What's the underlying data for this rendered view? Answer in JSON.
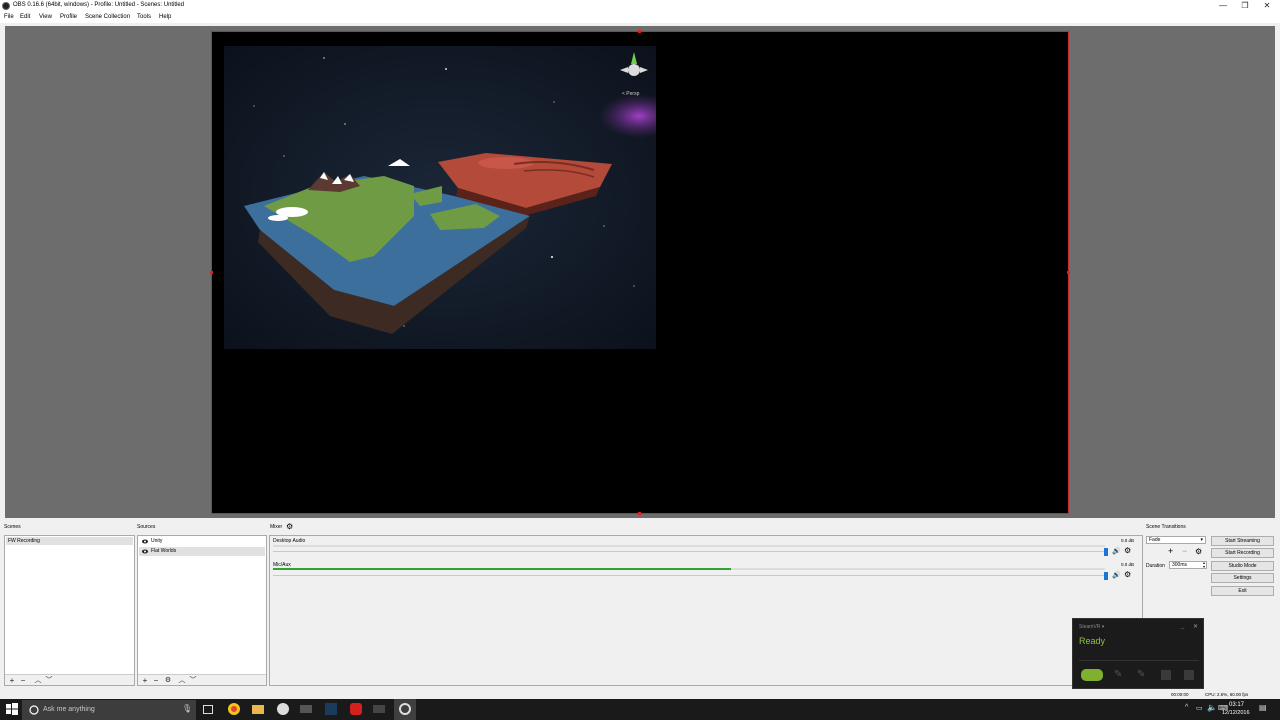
{
  "window": {
    "title": "OBS 0.16.6 (64bit, windows) - Profile: Untitled - Scenes: Untitled",
    "minimize": "—",
    "maximize": "❐",
    "close": "✕"
  },
  "menu": {
    "items": [
      "File",
      "Edit",
      "View",
      "Profile",
      "Scene Collection",
      "Tools",
      "Help"
    ]
  },
  "preview": {
    "gizmo_label": "< Persp"
  },
  "docks": {
    "scenes_label": "Scenes",
    "sources_label": "Sources",
    "mixer_label": "Mixer",
    "transitions_label": "Scene Transitions"
  },
  "scenes": {
    "items": [
      "FW Recording"
    ],
    "selected": "FW Recording"
  },
  "sources": {
    "items": [
      "Unity",
      "Flat Worlds"
    ],
    "selected": "Flat Worlds"
  },
  "mixer": {
    "tracks": [
      {
        "name": "Desktop Audio",
        "db": "0.0 dB",
        "level": 0.0
      },
      {
        "name": "Mic/Aux",
        "db": "0.0 dB",
        "level": 0.55
      }
    ]
  },
  "transitions": {
    "selected": "Fade",
    "duration_label": "Duration",
    "duration_value": "300ms"
  },
  "controls": {
    "start_streaming": "Start Streaming",
    "start_recording": "Start Recording",
    "studio_mode": "Studio Mode",
    "settings": "Settings",
    "exit": "Exit"
  },
  "steamvr": {
    "title": "SteamVR ▾",
    "status": "Ready",
    "accent": "#8fc43d"
  },
  "statusbar": {
    "time": "00:00:00",
    "cpu": "CPU: 2.6%, 60.00 fps"
  },
  "taskbar": {
    "search_placeholder": "Ask me anything",
    "clock_time": "03:17",
    "clock_date": "12/12/2016"
  },
  "colors": {
    "canvas_border": "#c52b2b",
    "meter_green": "#2fa52f",
    "slider_blue": "#1976d2"
  }
}
